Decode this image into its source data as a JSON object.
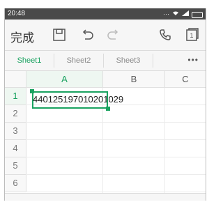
{
  "status": {
    "time": "20:48",
    "icons": [
      "dots-icon",
      "wifi-icon",
      "signal-icon",
      "battery-icon"
    ]
  },
  "toolbar": {
    "done_label": "完成",
    "buttons": [
      "save-icon",
      "undo-icon",
      "redo-icon",
      "phone-icon",
      "page-icon"
    ],
    "page_number": "1"
  },
  "tabs": {
    "items": [
      {
        "label": "Sheet1",
        "active": true
      },
      {
        "label": "Sheet2",
        "active": false
      },
      {
        "label": "Sheet3",
        "active": false
      }
    ],
    "more": "•••"
  },
  "grid": {
    "columns": [
      "A",
      "B",
      "C"
    ],
    "rows": [
      "1",
      "2",
      "3",
      "4",
      "5",
      "6"
    ],
    "cells": {
      "A1": "440125197010201029"
    },
    "selected": "A1",
    "accent": "#1aa260"
  }
}
